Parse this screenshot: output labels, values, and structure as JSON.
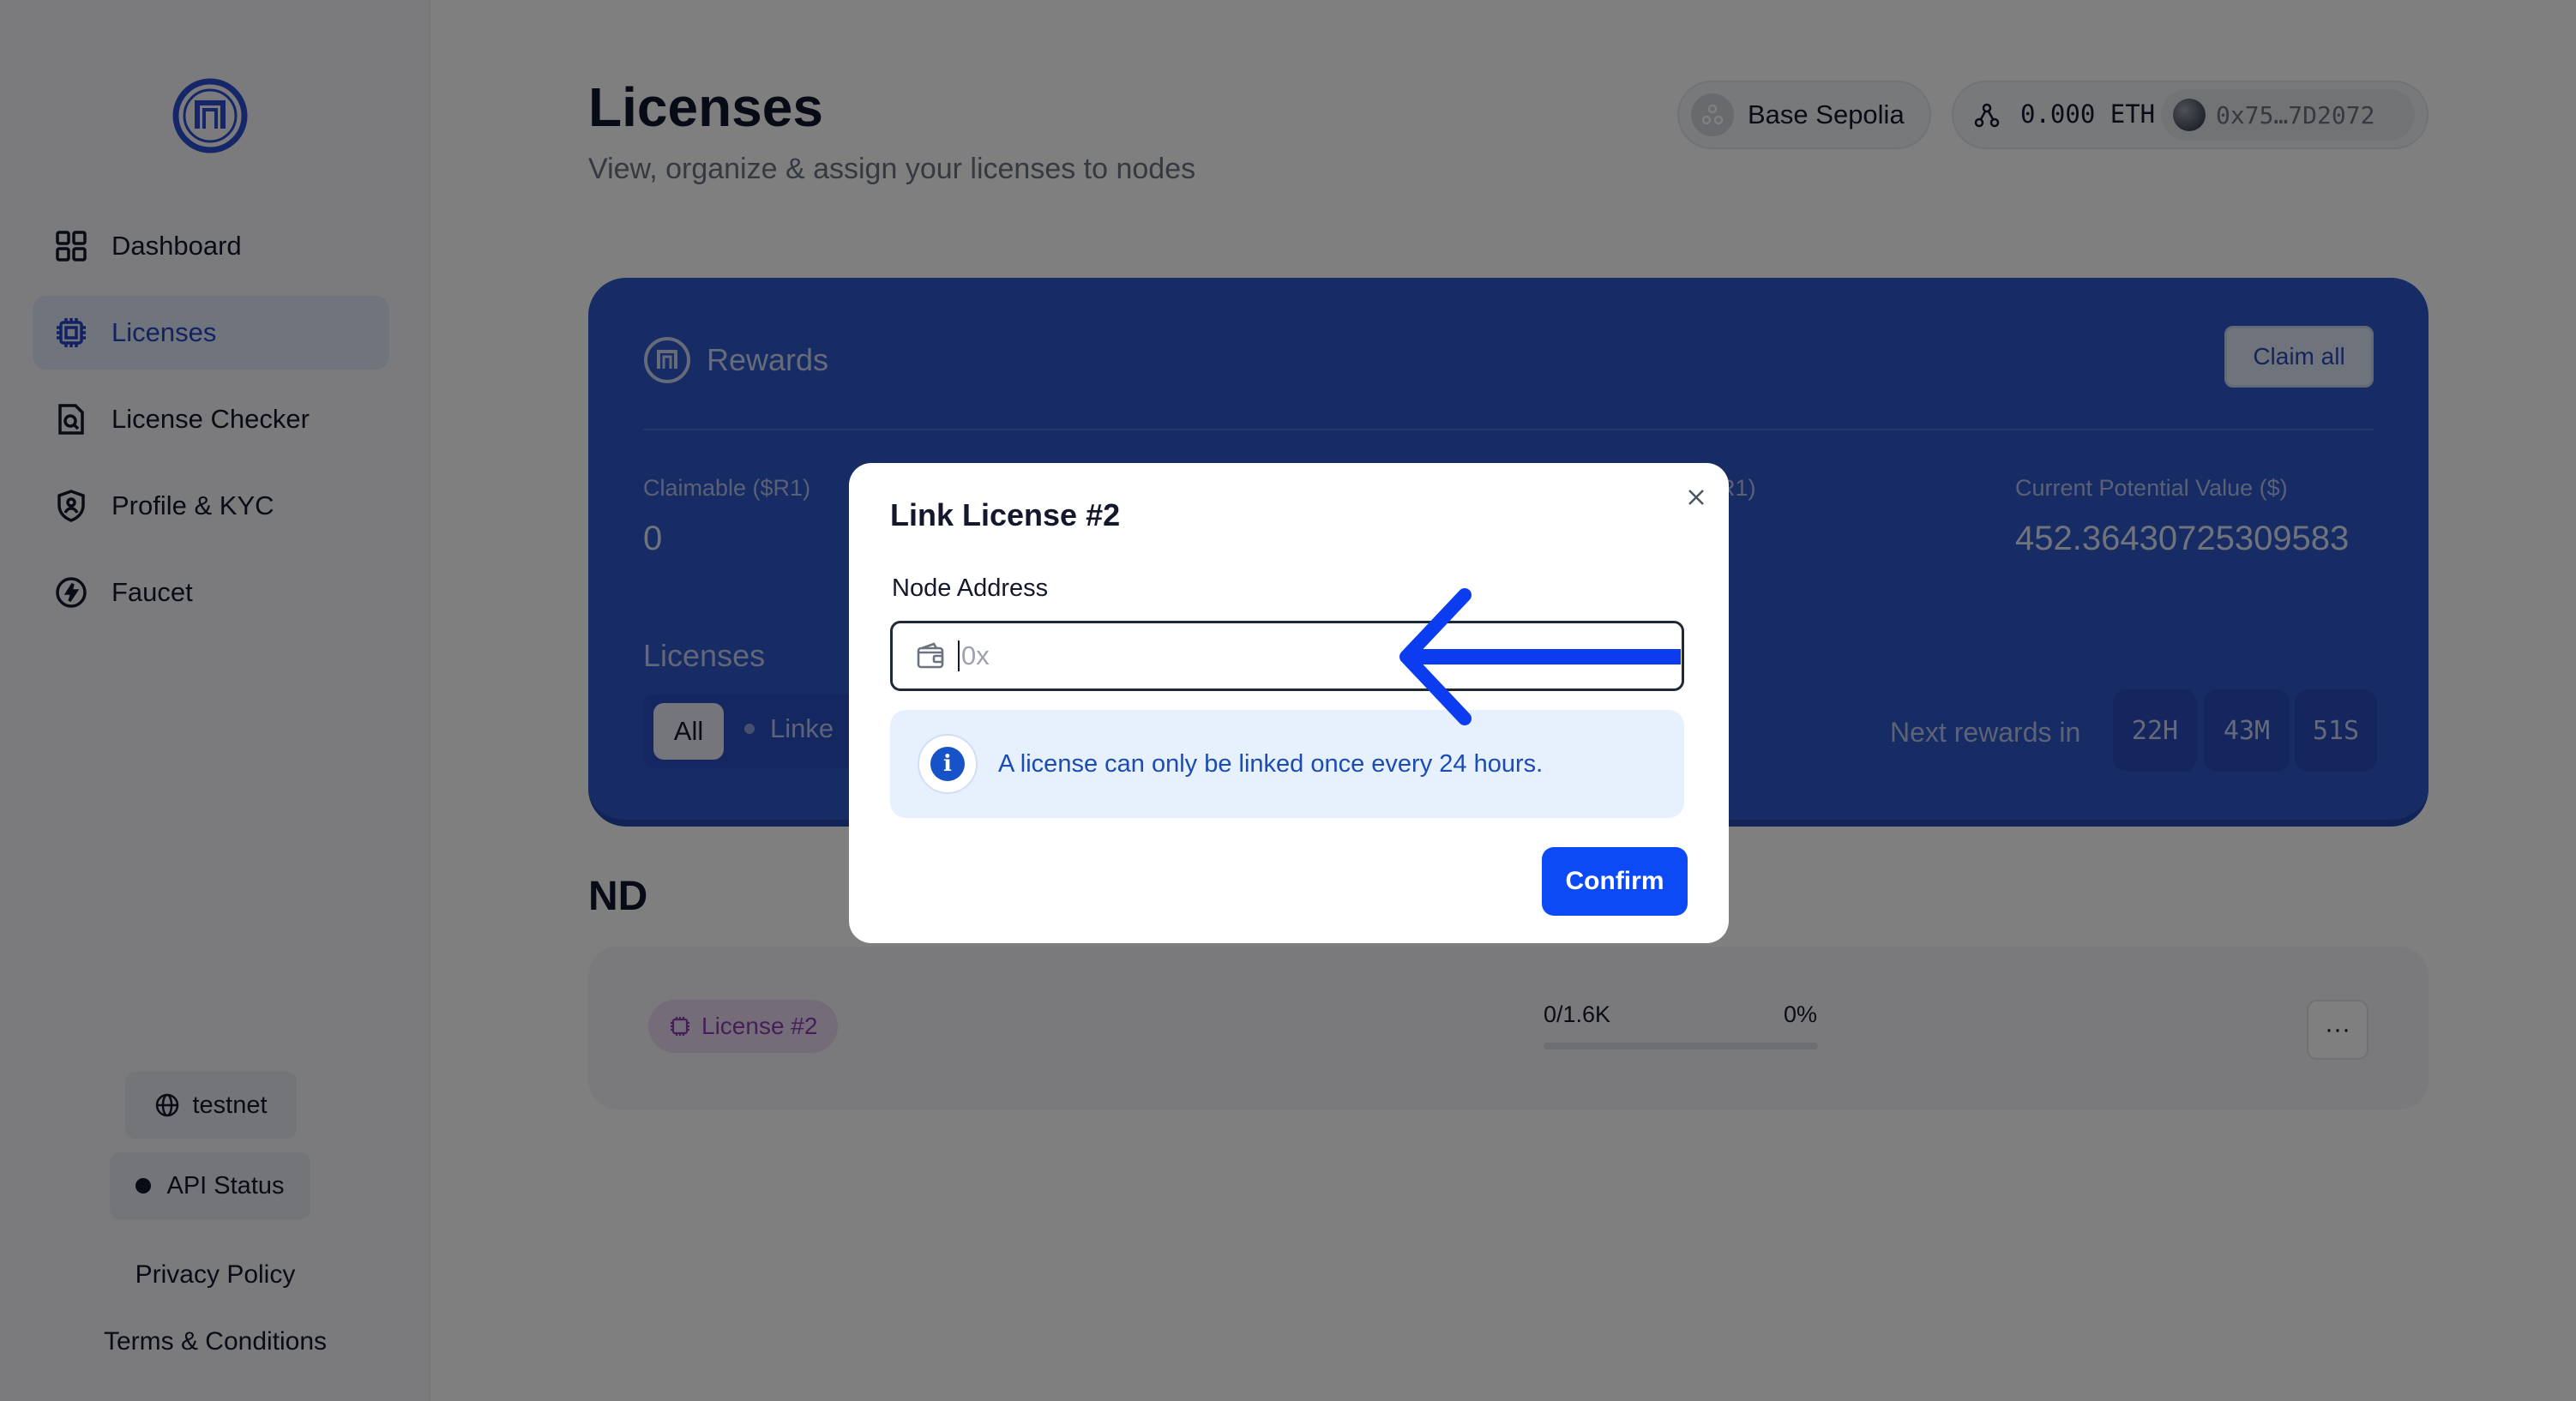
{
  "sidebar": {
    "items": [
      {
        "label": "Dashboard",
        "icon": "grid-icon",
        "active": false
      },
      {
        "label": "Licenses",
        "icon": "chip-icon",
        "active": true
      },
      {
        "label": "License Checker",
        "icon": "document-search-icon",
        "active": false
      },
      {
        "label": "Profile & KYC",
        "icon": "shield-user-icon",
        "active": false
      },
      {
        "label": "Faucet",
        "icon": "bolt-icon",
        "active": false
      }
    ],
    "network_label": "testnet",
    "api_status_label": "API Status",
    "privacy_label": "Privacy Policy",
    "terms_label": "Terms & Conditions"
  },
  "header": {
    "title": "Licenses",
    "subtitle": "View, organize & assign your licenses to nodes",
    "network_chip": "Base Sepolia",
    "balance": "0.000 ETH",
    "address": "0x75…7D2072"
  },
  "rewards": {
    "title": "Rewards",
    "claim_all": "Claim all",
    "claimable_label": "Claimable ($R1)",
    "claimable_value": "0",
    "hidden_label_fragment": "R1)",
    "potential_label": "Current Potential Value ($)",
    "potential_value": "452.36430725309583",
    "licenses_heading": "Licenses",
    "filter_all": "All",
    "filter_linked": "Linke",
    "next_rewards_label": "Next rewards in",
    "timer": {
      "hours": "22H",
      "minutes": "43M",
      "seconds": "51S"
    }
  },
  "section": {
    "heading": "ND",
    "license_tag": "License #2",
    "progress_count": "0/1.6K",
    "progress_pct": "0%",
    "progress_fraction": 0,
    "more": "···"
  },
  "modal": {
    "title": "Link License #2",
    "field_label": "Node Address",
    "placeholder": "0x",
    "info_text": "A license can only be linked once every 24 hours.",
    "confirm": "Confirm"
  },
  "colors": {
    "accent": "#0b4af5",
    "rewards_card": "#2e56c9",
    "arrow": "#0b3cf0"
  }
}
